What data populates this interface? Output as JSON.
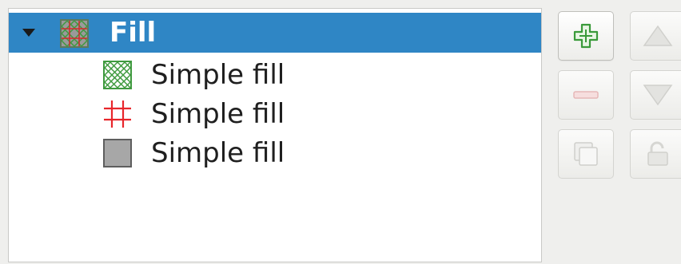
{
  "tree": {
    "rows": [
      {
        "label": "Fill",
        "expanded": true,
        "selected": true,
        "icon": "hatched-fill-preview-icon"
      },
      {
        "label": "Simple fill",
        "icon": "green-cross-hatch-icon"
      },
      {
        "label": "Simple fill",
        "icon": "red-grid-lines-icon"
      },
      {
        "label": "Simple fill",
        "icon": "gray-solid-fill-icon"
      }
    ]
  },
  "buttons": {
    "add": {
      "icon": "plus-icon",
      "enabled": true
    },
    "move_up": {
      "icon": "up-triangle-icon",
      "enabled": false
    },
    "remove": {
      "icon": "minus-icon",
      "enabled": false
    },
    "move_down": {
      "icon": "down-triangle-icon",
      "enabled": false
    },
    "duplicate": {
      "icon": "duplicate-icon",
      "enabled": false
    },
    "lock": {
      "icon": "unlock-icon",
      "enabled": false
    }
  },
  "colors": {
    "selection": "#2f86c5",
    "add_green": "#3a9a3a",
    "red_lines": "#e8262b",
    "gray_fill": "#a7a7a7"
  }
}
